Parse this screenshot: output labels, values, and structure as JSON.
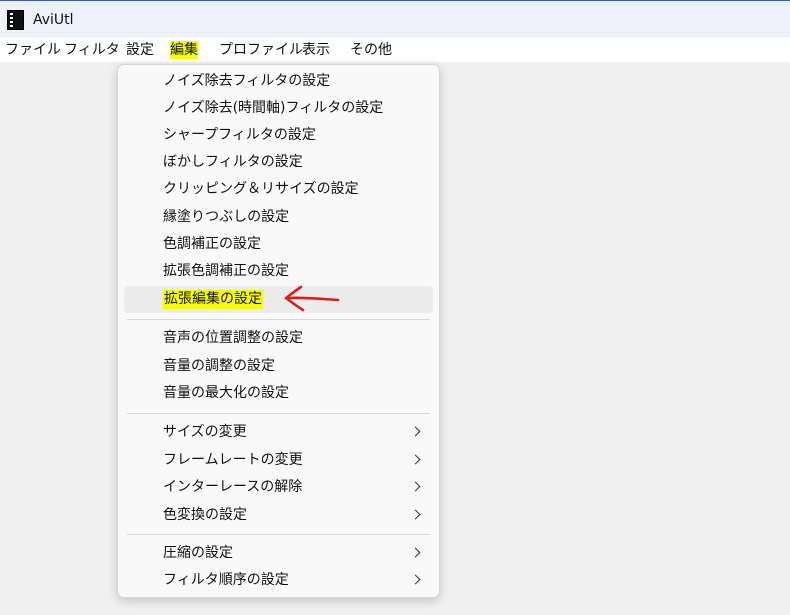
{
  "window": {
    "title": "AviUtl"
  },
  "menubar": {
    "items": [
      "ファイル",
      "フィルタ",
      "設定",
      "編集",
      "プロファイル",
      "表示",
      "その他"
    ],
    "highlighted_item": "編集"
  },
  "dropdown": {
    "groups": [
      {
        "items": [
          {
            "label": "ノイズ除去フィルタの設定"
          },
          {
            "label": "ノイズ除去(時間軸)フィルタの設定"
          },
          {
            "label": "シャープフィルタの設定"
          },
          {
            "label": "ぼかしフィルタの設定"
          },
          {
            "label": "クリッピング＆リサイズの設定"
          },
          {
            "label": "縁塗りつぶしの設定"
          },
          {
            "label": "色調補正の設定"
          },
          {
            "label": "拡張色調補正の設定"
          },
          {
            "label": "拡張編集の設定",
            "highlighted": true,
            "hovered": true
          }
        ]
      },
      {
        "items": [
          {
            "label": "音声の位置調整の設定"
          },
          {
            "label": "音量の調整の設定"
          },
          {
            "label": "音量の最大化の設定"
          }
        ]
      },
      {
        "items": [
          {
            "label": "サイズの変更",
            "submenu": true
          },
          {
            "label": "フレームレートの変更",
            "submenu": true
          },
          {
            "label": "インターレースの解除",
            "submenu": true
          },
          {
            "label": "色変換の設定",
            "submenu": true
          }
        ]
      },
      {
        "items": [
          {
            "label": "圧縮の設定",
            "submenu": true
          },
          {
            "label": "フィルタ順序の設定",
            "submenu": true
          }
        ]
      }
    ]
  },
  "annotation": {
    "icon": "red-arrow-left-icon",
    "color": "#e01b1b"
  },
  "colors": {
    "highlight": "#f6ff00",
    "titlebar": "#eef1f9",
    "menu_background": "#f9f9f9",
    "hover": "#ececec"
  }
}
